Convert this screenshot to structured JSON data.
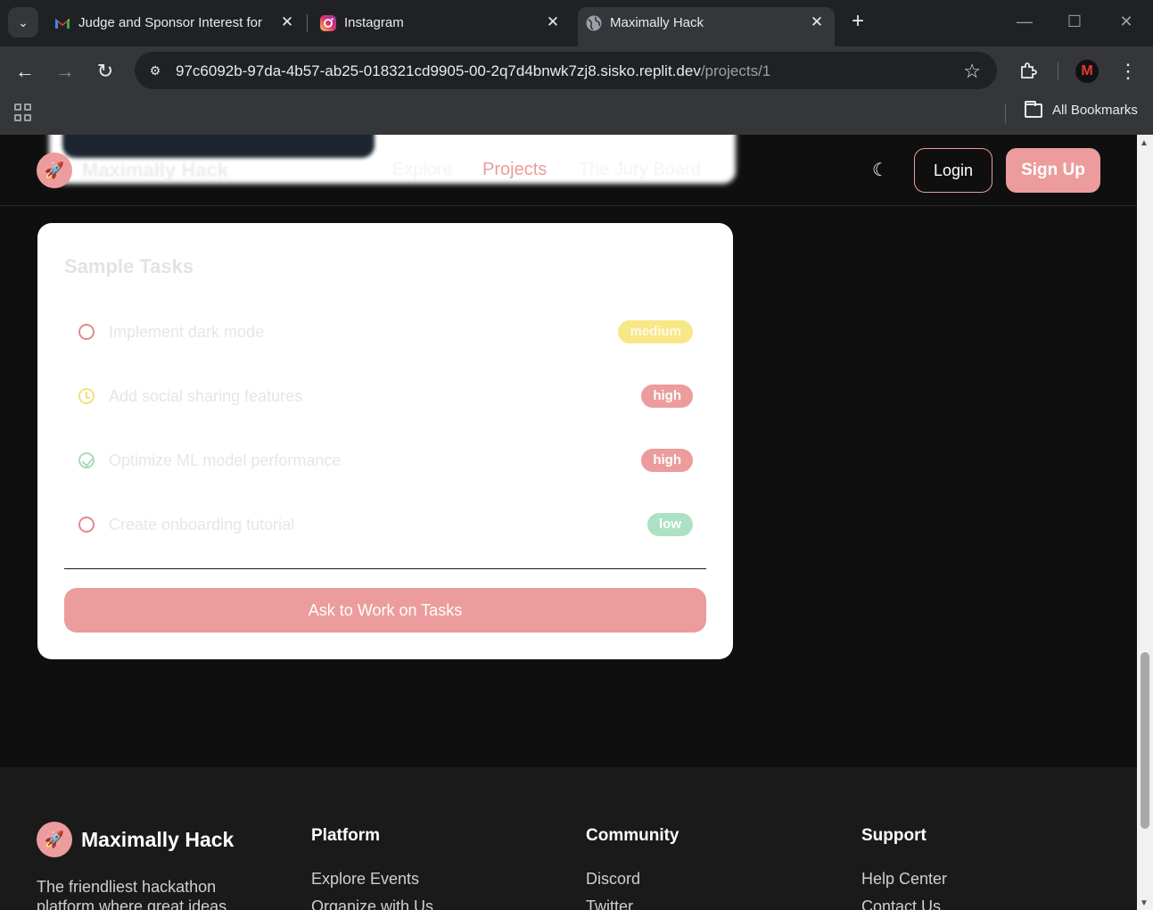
{
  "browser": {
    "tabs": [
      {
        "title": "Judge and Sponsor Interest for",
        "icon": "gmail-icon"
      },
      {
        "title": "Instagram",
        "icon": "instagram-icon"
      },
      {
        "title": "Maximally Hack",
        "icon": "globe-icon"
      }
    ],
    "url_host": "97c6092b-97da-4b57-ab25-018321cd9905-00-2q7d4bnwk7zj8.sisko.replit.dev",
    "url_path": "/projects/1",
    "bookmarks_label": "All Bookmarks",
    "profile_initial": "M"
  },
  "header": {
    "brand": "Maximally Hack",
    "nav": [
      "Explore",
      "Projects",
      "The Jury Board"
    ],
    "active_nav": "Projects",
    "login_label": "Login",
    "signup_label": "Sign Up"
  },
  "tasks_card": {
    "title": "Sample Tasks",
    "tasks": [
      {
        "name": "Implement dark mode",
        "status": "todo",
        "priority": "medium"
      },
      {
        "name": "Add social sharing features",
        "status": "in-progress",
        "priority": "high"
      },
      {
        "name": "Optimize ML model performance",
        "status": "done",
        "priority": "high"
      },
      {
        "name": "Create onboarding tutorial",
        "status": "todo",
        "priority": "low"
      }
    ],
    "cta_label": "Ask to Work on Tasks"
  },
  "footer": {
    "brand": "Maximally Hack",
    "tagline": "The friendliest hackathon platform where great ideas",
    "columns": [
      {
        "heading": "Platform",
        "links": [
          "Explore Events",
          "Organize with Us"
        ]
      },
      {
        "heading": "Community",
        "links": [
          "Discord",
          "Twitter"
        ]
      },
      {
        "heading": "Support",
        "links": [
          "Help Center",
          "Contact Us"
        ]
      }
    ]
  },
  "colors": {
    "accent": "#ec9c9c",
    "medium": "#f8e786",
    "low": "#ace2c3",
    "page_bg": "#0f0f0f"
  }
}
